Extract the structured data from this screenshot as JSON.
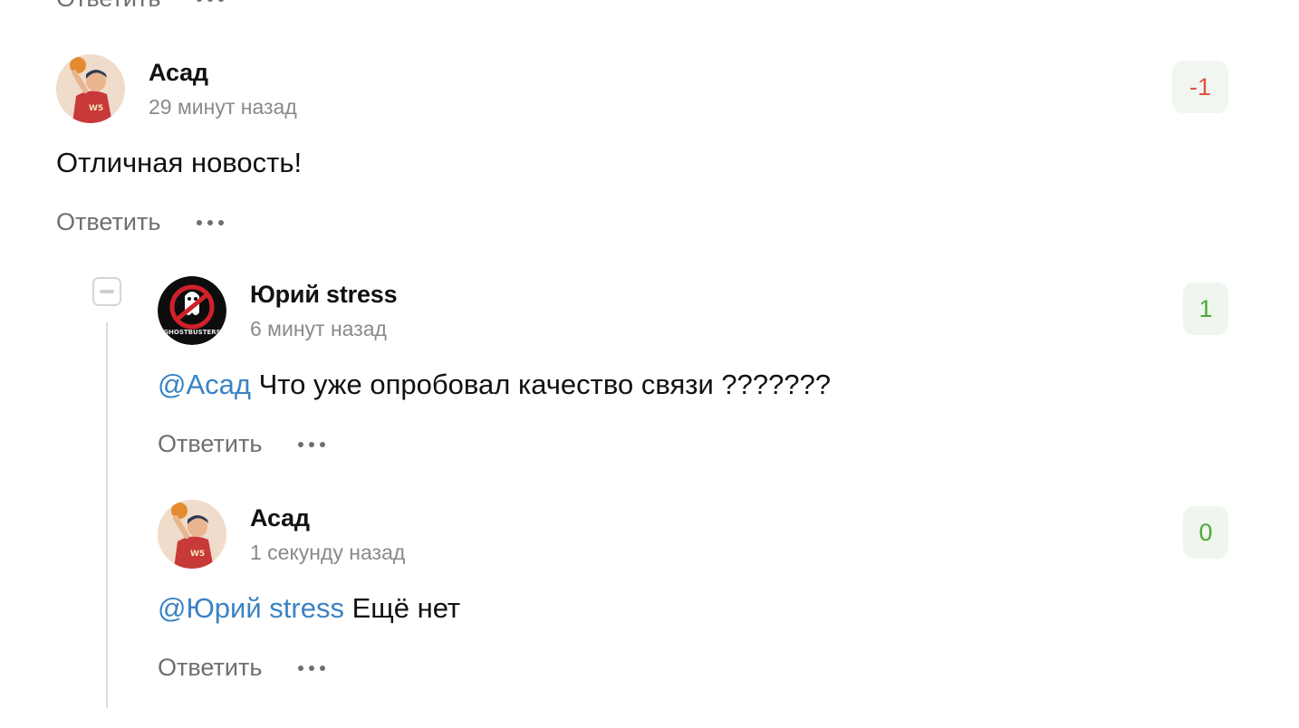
{
  "top_clipped": {
    "reply_label": "Ответить"
  },
  "comments": [
    {
      "author": "Асад",
      "time": "29 минут назад",
      "score": "-1",
      "score_kind": "negative",
      "mention": "",
      "text": "Отличная новость!",
      "reply_label": "Ответить",
      "avatar_icon": "basketball-player-avatar"
    },
    {
      "author": "Юрий stress",
      "time": "6 минут назад",
      "score": "1",
      "score_kind": "positive",
      "mention": "@Асад",
      "text": " Что уже опробовал качество связи ???????",
      "reply_label": "Ответить",
      "avatar_icon": "ghostbusters-logo-avatar",
      "avatar_text": "GHOSTBUSTERS"
    },
    {
      "author": "Асад",
      "time": "1 секунду назад",
      "score": "0",
      "score_kind": "positive",
      "mention": "@Юрий stress",
      "text": " Ещё нет",
      "reply_label": "Ответить",
      "avatar_icon": "basketball-player-avatar"
    }
  ],
  "colors": {
    "mention": "#3a83c4",
    "score_negative": "#e0524a",
    "score_positive": "#4daa3a",
    "score_bg": "#eef6ee"
  }
}
